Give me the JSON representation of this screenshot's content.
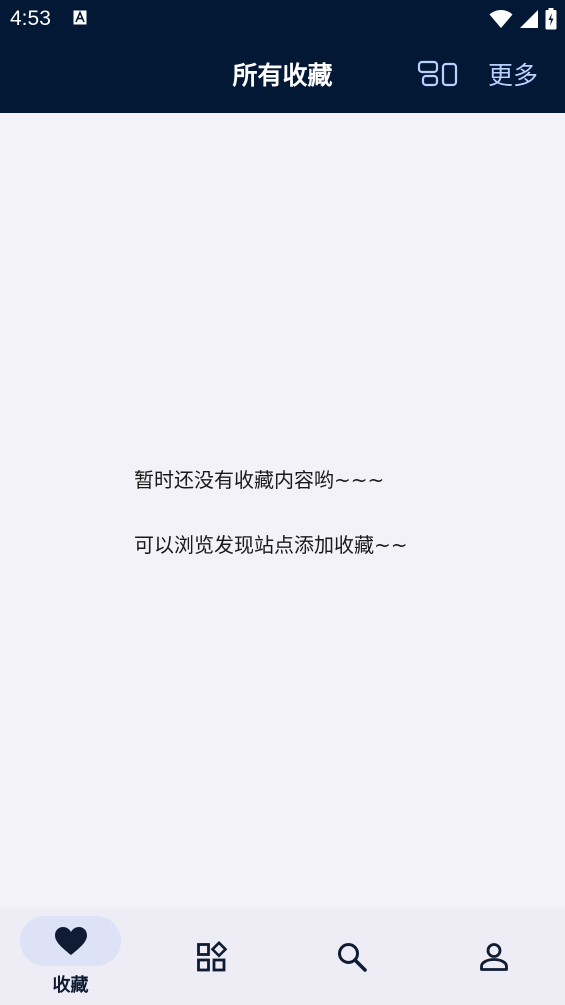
{
  "status_bar": {
    "time": "4:53",
    "icons": [
      "notification-a-icon",
      "wifi-icon",
      "cellular-signal-icon",
      "battery-charging-icon"
    ]
  },
  "app_bar": {
    "title": "所有收藏",
    "layout_toggle_icon": "layout-toggle-icon",
    "more_label": "更多"
  },
  "empty_state": {
    "line1": "暂时还没有收藏内容哟~~~",
    "line2": "可以浏览发现站点添加收藏~~"
  },
  "bottom_nav": {
    "items": [
      {
        "id": "favorites",
        "label": "收藏",
        "icon": "heart-icon",
        "active": true
      },
      {
        "id": "discover",
        "label": "",
        "icon": "apps-icon",
        "active": false
      },
      {
        "id": "search",
        "label": "",
        "icon": "search-icon",
        "active": false
      },
      {
        "id": "profile",
        "label": "",
        "icon": "person-icon",
        "active": false
      }
    ]
  },
  "colors": {
    "header_bg": "#031835",
    "content_bg": "#f3f2f9",
    "nav_bg": "#eeedf6",
    "active_pill": "#dde2f7",
    "more_text": "#b8d1ff",
    "icon_dark": "#0f1c33"
  }
}
